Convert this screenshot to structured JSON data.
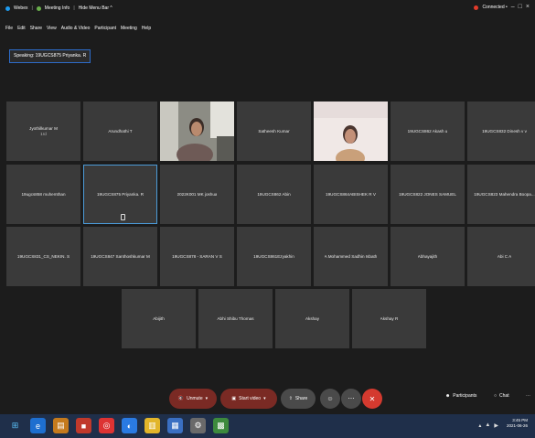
{
  "window": {
    "title_items": [
      "Webex",
      "Meeting Info",
      "Hide Menu Bar ^"
    ],
    "connection_status": "Connected •",
    "controls": [
      "–",
      "□",
      "×"
    ]
  },
  "menu": [
    "File",
    "Edit",
    "Share",
    "View",
    "Audio & Video",
    "Participant",
    "Meeting",
    "Help"
  ],
  "speaking": "Speaking: 19UGCS875 Priyanka. R",
  "participants": {
    "row1": [
      "Jyothilkumar M",
      "Arundhathi T",
      "",
      "Satheesh Kumar",
      "",
      "19UGCS862 Akash u",
      "19UGCS832 Dinesh v v"
    ],
    "row1_sub": "1rd",
    "row2": [
      "19ugcs858 muhemthan",
      "19UGCS875 Priyanka. R",
      "2022K001 MK joshua",
      "19UGCS862 Abin",
      "19UGCS864ABISHEK R V",
      "19UGCS822 JONES SAMUEL",
      "19UGCS823 Mahendra Boopa..."
    ],
    "row3": [
      "19UGCS831_CS_NEKIN. S",
      "19UGCS847 Santhoshkumar M",
      "19UGCS878 - SARAN V S",
      "19UGCS861Ezyakhin",
      "A Mohammed Sadhin Isbath",
      "Abhayajith",
      "Abi C A"
    ],
    "row4": [
      "Abijith",
      "Abhi Shibu Thomas",
      "Akshay",
      "Akshay R"
    ]
  },
  "toolbar": {
    "unmute": "Unmute",
    "start_video": "Start video",
    "share": "Share",
    "participants": "Participants",
    "chat": "Chat"
  },
  "taskbar": {
    "time": "3:45 PM",
    "date": "2021-06-26"
  },
  "colors": {
    "background": "#1c1c1c",
    "tile": "#3a3a3a",
    "active_border": "#4b9bd8",
    "end_call": "#d43a2f",
    "taskbar": "#1f2f4a"
  }
}
